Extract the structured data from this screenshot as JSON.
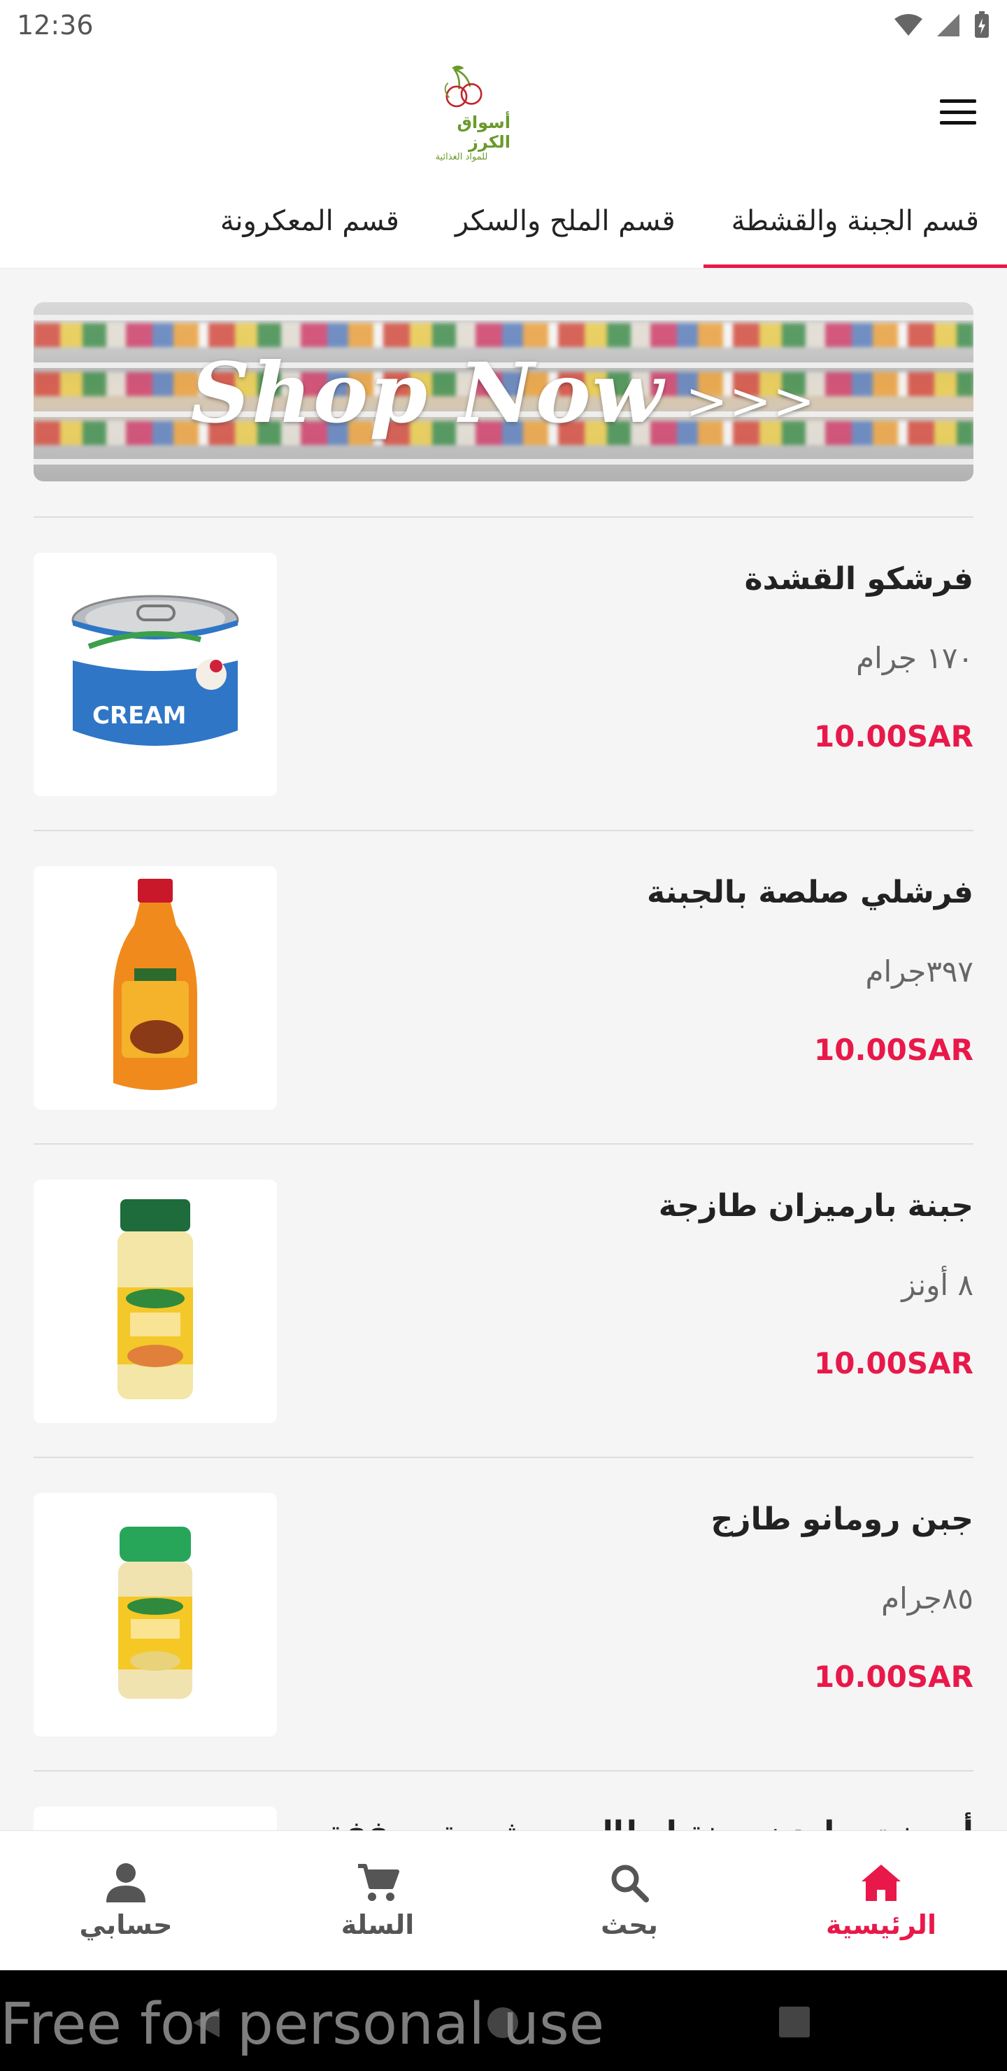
{
  "status_bar": {
    "time": "12:36",
    "icons": [
      "wifi-icon",
      "signal-icon",
      "battery-charging-icon"
    ]
  },
  "header": {
    "logo_name": "أسواق الكرز",
    "logo_subtitle": "للمواد الغذائية",
    "menu_icon": "hamburger-menu-icon"
  },
  "tabs": [
    {
      "label": "قسم الجبنة والقشطة",
      "active": true
    },
    {
      "label": "قسم الملح والسكر",
      "active": false
    },
    {
      "label": "قسم المعكرونة",
      "active": false
    }
  ],
  "banner": {
    "text": "Shop Now",
    "arrows": ">>>"
  },
  "products": [
    {
      "name": "فرشكو القشدة",
      "size": "١٧٠ جرام",
      "price": "10.00SAR",
      "image_icon": "cream-can-icon"
    },
    {
      "name": "فرشلي صلصة بالجبنة",
      "size": "٣٩٧جرام",
      "price": "10.00SAR",
      "image_icon": "cheese-sauce-bottle-icon"
    },
    {
      "name": "جبنة بارميزان طازجة",
      "size": "٨ أونز",
      "price": "10.00SAR",
      "image_icon": "parmesan-jar-icon"
    },
    {
      "name": "جبن رومانو طازج",
      "size": "٨٥جرام",
      "price": "10.00SAR",
      "image_icon": "romano-jar-icon"
    },
    {
      "name": "أوسنت جاردن جبنة إيطالي مبشورة مجففة",
      "size": "",
      "price": "",
      "image_icon": "grated-cheese-icon"
    }
  ],
  "bottom_nav": [
    {
      "label": "الرئيسية",
      "icon": "home-icon",
      "active": true
    },
    {
      "label": "بحث",
      "icon": "search-icon",
      "active": false
    },
    {
      "label": "السلة",
      "icon": "cart-icon",
      "active": false
    },
    {
      "label": "حسابي",
      "icon": "person-icon",
      "active": false
    }
  ],
  "watermark": "Free for personal use",
  "colors": {
    "accent": "#e8194a",
    "logo_green": "#6a9a2c",
    "background": "#f5f5f5"
  }
}
